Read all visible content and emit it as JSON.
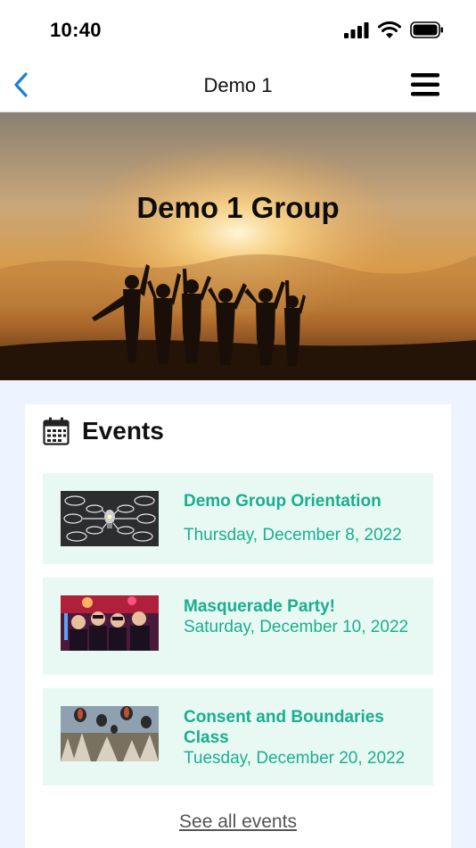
{
  "status_bar": {
    "time": "10:40"
  },
  "nav": {
    "title": "Demo 1"
  },
  "hero": {
    "title": "Demo 1 Group"
  },
  "events": {
    "title": "Events",
    "items": [
      {
        "name": "Demo Group Orientation",
        "date": "Thursday, December 8, 2022"
      },
      {
        "name": "Masquerade Party!",
        "date": "Saturday, December 10, 2022"
      },
      {
        "name": "Consent and Boundaries Class",
        "date": "Tuesday, December 20, 2022"
      }
    ],
    "see_all_label": "See all events"
  },
  "colors": {
    "accent": "#1aae8e",
    "event_bg": "#e8f9f3",
    "nav_icon": "#1a7fe0",
    "page_bg": "#eef4ff"
  }
}
